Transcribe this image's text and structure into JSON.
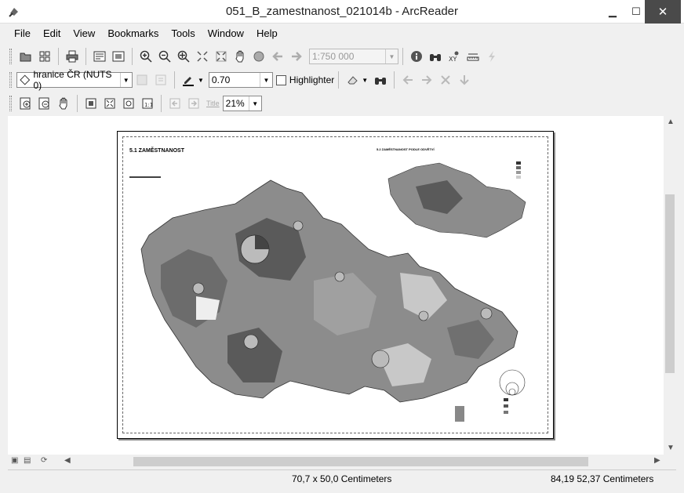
{
  "window": {
    "title": "051_B_zamestnanost_021014b - ArcReader",
    "minimize": "▁",
    "maximize": "☐",
    "close": "✕"
  },
  "menu": [
    "File",
    "Edit",
    "View",
    "Bookmarks",
    "Tools",
    "Window",
    "Help"
  ],
  "toolbar1": {
    "scale_value": "1:750 000"
  },
  "toolbar2": {
    "layer_value": "hranice ČR (NUTS 0)",
    "line_width": "0.70",
    "highlighter_label": "Highlighter"
  },
  "toolbar3": {
    "title_tool": "Title",
    "zoom_value": "21%"
  },
  "map": {
    "title": "5.1 ZAMĚSTNANOST",
    "inset_title": "5.2 ZAMĚSTNANOST PODLE ODVĚTVÍ"
  },
  "status": {
    "page_size": "70,7 x 50,0 Centimeters",
    "cursor": "84,19  52,37 Centimeters"
  },
  "colors": {
    "close_bg": "#4a4a4a",
    "map_dark": "#5a5a5a",
    "map_mid": "#8c8c8c",
    "map_light": "#c8c8c8"
  },
  "icons": [
    "app-icon",
    "open-icon",
    "layers-icon",
    "print-icon",
    "layout-view-icon",
    "data-view-icon",
    "zoom-in-icon",
    "zoom-out-icon",
    "fixed-zoom-icon",
    "full-extent-icon",
    "pan-icon",
    "globe-icon",
    "back-icon",
    "forward-icon",
    "identify-icon",
    "find-icon",
    "xy-icon",
    "measure-icon",
    "hyperlink-icon",
    "pen-icon",
    "eraser-icon"
  ]
}
